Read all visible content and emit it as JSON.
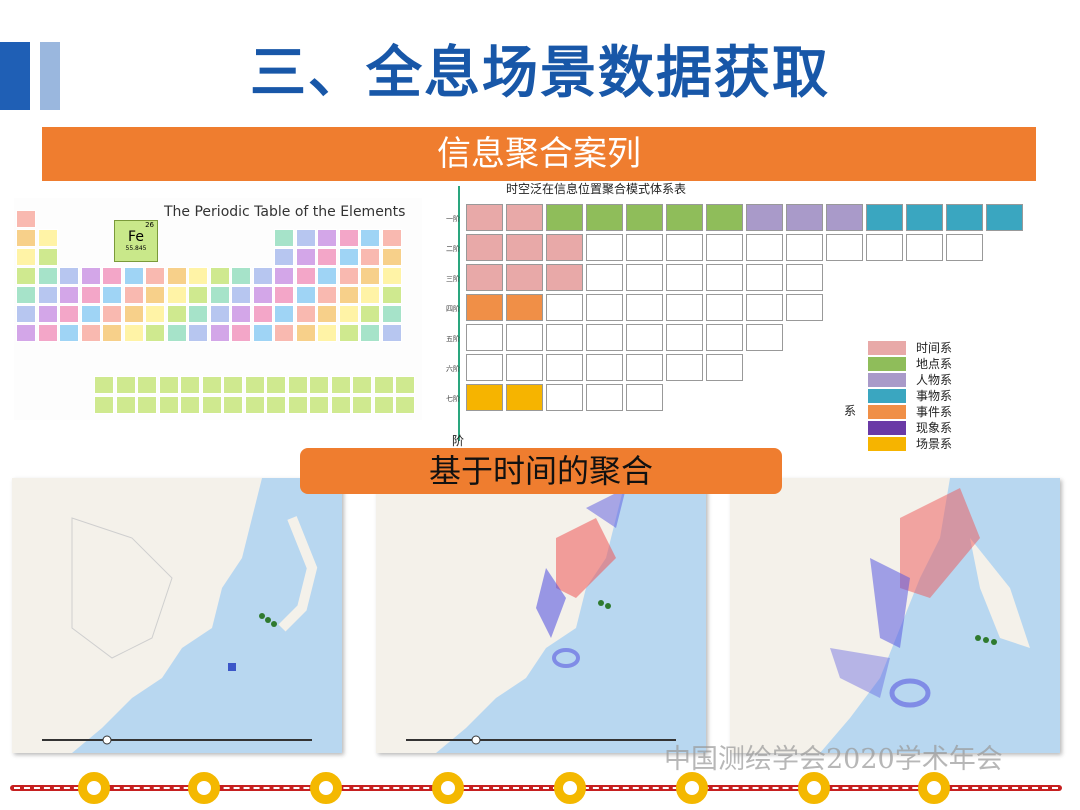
{
  "header": {
    "title": "三、全息场景数据获取"
  },
  "banner_top": {
    "label": "信息聚合案列"
  },
  "periodic_table": {
    "title": "The Periodic Table of the Elements",
    "featured": {
      "symbol": "Fe",
      "number": "26",
      "mass": "55.845"
    }
  },
  "matrix": {
    "title": "时空泛在信息位置聚合模式体系表",
    "rows": [
      "一阶",
      "二阶",
      "三阶",
      "四阶",
      "五阶",
      "六阶",
      "七阶"
    ],
    "axis_label_bottom": "阶",
    "axis_label_right": "系"
  },
  "legend": {
    "items": [
      {
        "label": "时间系",
        "color": "#e8a9a8"
      },
      {
        "label": "地点系",
        "color": "#8fbd5a"
      },
      {
        "label": "人物系",
        "color": "#a99ac9"
      },
      {
        "label": "事物系",
        "color": "#3aa6c0"
      },
      {
        "label": "事件系",
        "color": "#f08f47"
      },
      {
        "label": "现象系",
        "color": "#6a3aa6"
      },
      {
        "label": "场景系",
        "color": "#f6b400"
      }
    ]
  },
  "banner_mid": {
    "label": "基于时间的聚合"
  },
  "watermark": {
    "text": "中国测绘学会2020学术年会"
  },
  "colors": {
    "accent_blue": "#1f5fb5",
    "orange": "#ef7d2f",
    "timeline_red": "#c62020",
    "node_yellow": "#f4b800"
  }
}
